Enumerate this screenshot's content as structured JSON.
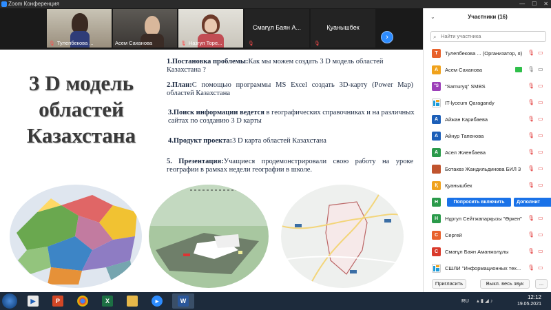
{
  "window": {
    "title": "Zoom Конференция"
  },
  "video_strip": {
    "tiles": [
      {
        "name": "Тулепбекова ..."
      },
      {
        "name": "Асем Саханова"
      },
      {
        "name": "Назгул Торе..."
      },
      {
        "name": "Смағұл Баян А..."
      },
      {
        "name": "Қуанышбек"
      }
    ],
    "next_icon": "chevron-right-icon"
  },
  "slide": {
    "title_lines": [
      "3 D модель",
      "областей",
      "Казахстана"
    ],
    "items": [
      {
        "label": "1.Постановка проблемы:",
        "text": "Как мы можем создать 3 D модель областей Казахстана ?"
      },
      {
        "label": "2.План:",
        "text": "С помощью программы  MS Excel создать  3D-карту  (Power Map) областей Казахстана"
      },
      {
        "label": "3.Поиск информации ведется",
        "text": " в географических справочниках  и на различных сайтах по созданию 3 D карты"
      },
      {
        "label": "4.Продукт  проекта:",
        "text": "3 D карта областей Казахстана"
      },
      {
        "label": "5.  Презентация:",
        "text": "Учащиеся продемонстрировали свою работу на уроке географии в рамках недели географии в школе."
      }
    ]
  },
  "participants_panel": {
    "title": "Участники (16)",
    "search_placeholder": "Найти участника",
    "participants": [
      {
        "initial": "Т",
        "name": "Тулепбекова ... (Организатор, я)",
        "color": "#e8622c"
      },
      {
        "initial": "А",
        "name": "Асем Саханова",
        "color": "#f0a21c"
      },
      {
        "initial": "\"S",
        "name": "\"Samuryq\"  SMBS",
        "color": "#9c3fb8"
      },
      {
        "initial": "",
        "name": "IT-lyceum Qaragandy",
        "color": "#ffffff"
      },
      {
        "initial": "А",
        "name": "Айжан Карибаева",
        "color": "#1c5fb8"
      },
      {
        "initial": "А",
        "name": "Айнур Тапенова",
        "color": "#1c5fb8"
      },
      {
        "initial": "А",
        "name": "Асел Жиенбаева",
        "color": "#2a9a4a"
      },
      {
        "initial": "",
        "name": "Ботакөз Жандильдинова БИЛ 3",
        "color": "#c0542e"
      },
      {
        "initial": "Қ",
        "name": "Қуанышбек",
        "color": "#f0a21c"
      },
      {
        "initial": "Н",
        "name": "",
        "color": "#2a9a4a"
      },
      {
        "initial": "Н",
        "name": "Нұргул Сейтжапарқызы \"Өркен\"",
        "color": "#2a9a4a"
      },
      {
        "initial": "С",
        "name": "Сергей",
        "color": "#e8622c"
      },
      {
        "initial": "С",
        "name": "Смағұл Баян Аманжолұлы",
        "color": "#d93a2b"
      },
      {
        "initial": "",
        "name": "СШЛИ \"Информационных тех...",
        "color": "#ffffff"
      }
    ],
    "ask_unmute_label": "Попросить включить",
    "more_label": "Дополнит",
    "footer": {
      "invite": "Пригласить",
      "mute_all": "Выкл. весь звук",
      "more": "..."
    }
  },
  "taskbar": {
    "lang": "RU",
    "time": "12:12",
    "date": "19.05.2021"
  }
}
